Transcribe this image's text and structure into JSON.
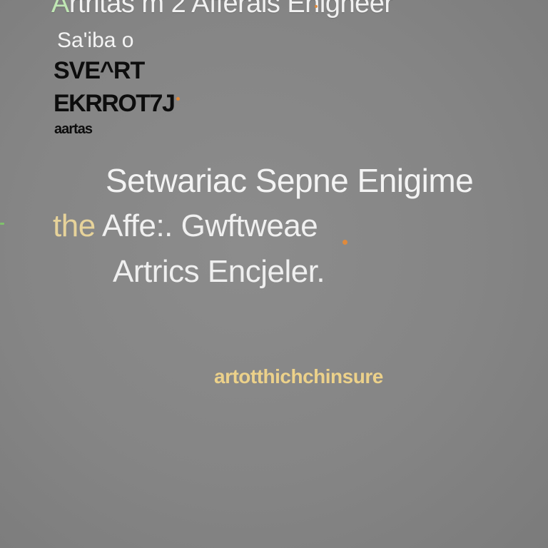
{
  "lines": {
    "top_prefix": "A",
    "top_rest": "rtritas m 2 Afferais  Enigneer",
    "white_small": "Sa'iba o",
    "black_1": "SVE^RT",
    "black_2": "EKRROT7J",
    "black_3": "aartas",
    "main_1": "Setwariac Sepne Enigime",
    "main_2_gold": "the",
    "main_2_rest": " Affe:.  Gwftweae",
    "main_3": "Artrics  Encjeler.",
    "gold_line": "artotthichchinsure"
  },
  "colors": {
    "background": "#858585",
    "accent_orange": "#e08a3c",
    "accent_green": "#7fc36b",
    "gold": "#ecd18a"
  }
}
